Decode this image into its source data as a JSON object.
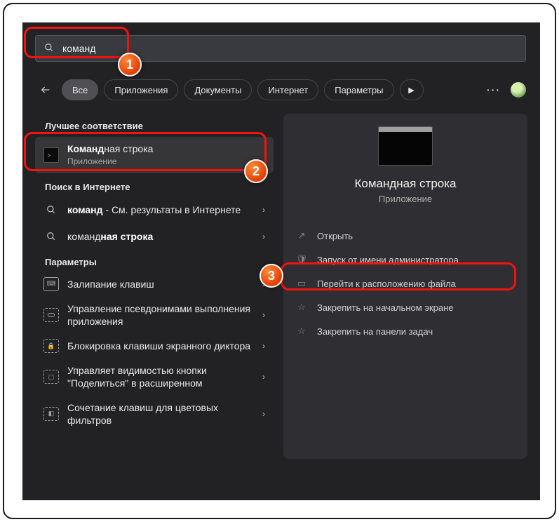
{
  "search": {
    "query": "команд"
  },
  "filters": {
    "all": "Все",
    "apps": "Приложения",
    "docs": "Документы",
    "internet": "Интернет",
    "settings": "Параметры"
  },
  "sections": {
    "best": "Лучшее соответствие",
    "web": "Поиск в Интернете",
    "settings": "Параметры"
  },
  "best": {
    "title_pre": "Команд",
    "title_post": "ная строка",
    "sub": "Приложение"
  },
  "web": {
    "r1_pre": "команд",
    "r1_post": " - См. результаты в Интернете",
    "r2_pre": "команд",
    "r2_post": "ная строка"
  },
  "settings_items": [
    "Залипание клавиш",
    "Управление псевдонимами выполнения приложения",
    "Блокировка клавиши экранного диктора",
    "Управляет видимостью кнопки \"Поделиться\" в расширенном",
    "Сочетание клавиш для цветовых фильтров"
  ],
  "preview": {
    "title": "Командная строка",
    "sub": "Приложение"
  },
  "actions": {
    "open": "Открыть",
    "admin": "Запуск от имени администратора",
    "loc": "Перейти к расположению файла",
    "pin_start": "Закрепить на начальном экране",
    "pin_task": "Закрепить на панели задач"
  },
  "badges": {
    "b1": "1",
    "b2": "2",
    "b3": "3"
  }
}
